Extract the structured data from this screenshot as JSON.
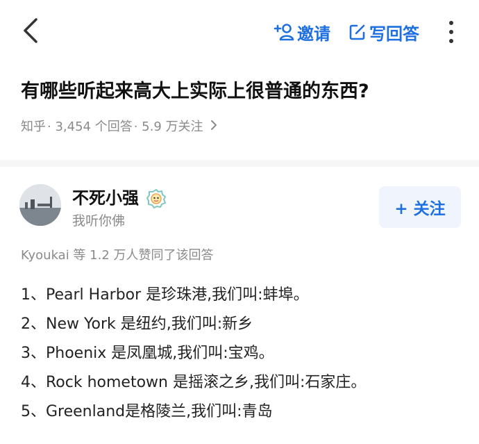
{
  "topbar": {
    "back_icon": "chevron-left-icon",
    "invite_label": "邀请",
    "invite_icon": "add-person-icon",
    "write_answer_label": "写回答",
    "write_answer_icon": "edit-icon",
    "more_icon": "more-vertical-icon",
    "accent_color": "#1e6fe0"
  },
  "question": {
    "title": "有哪些听起来高大上实际上很普通的东西?",
    "source": "知乎",
    "answers_count": "· 3,454 个回答",
    "followers_count": "· 5.9 万关注",
    "chevron_icon": "chevron-right-icon"
  },
  "answer": {
    "author": {
      "name": "不死小强",
      "bio": "我听你佛",
      "badge_icon": "member-badge-icon"
    },
    "follow_label": "+ 关注",
    "upvote_text": "Kyoukai 等 1.2 万人赞同了该回答",
    "items": [
      "1、Pearl Harbor 是珍珠港,我们叫:蚌埠。",
      "2、New York 是纽约,我们叫:新乡",
      "3、Phoenix 是凤凰城,我们叫:宝鸡。",
      "4、Rock hometown 是摇滚之乡,我们叫:石家庄。",
      "5、Greenland是格陵兰,我们叫:青岛"
    ]
  }
}
